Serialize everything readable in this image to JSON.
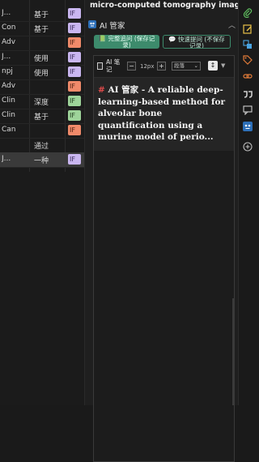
{
  "left_table": {
    "rows": [
      {
        "col1": "J...",
        "col2": "基于",
        "tag": "IF",
        "tag_color": "#c9b6f0"
      },
      {
        "col1": "Con",
        "col2": "基于",
        "tag": "IF",
        "tag_color": "#c9b6f0"
      },
      {
        "col1": "Adv",
        "col2": "",
        "tag": "IF",
        "tag_color": "#f08a6a"
      },
      {
        "col1": "J...",
        "col2": "使用",
        "tag": "IF",
        "tag_color": "#c9b6f0"
      },
      {
        "col1": "npj",
        "col2": "使用",
        "tag": "IF",
        "tag_color": "#c9b6f0"
      },
      {
        "col1": "Adv",
        "col2": "",
        "tag": "IF",
        "tag_color": "#f08a6a"
      },
      {
        "col1": "Clin",
        "col2": "深度",
        "tag": "IF",
        "tag_color": "#9ed49a"
      },
      {
        "col1": "Clin",
        "col2": "基于",
        "tag": "IF",
        "tag_color": "#9ed49a"
      },
      {
        "col1": "Can",
        "col2": "",
        "tag": "IF",
        "tag_color": "#f08a6a"
      },
      {
        "col1": "",
        "col2": "通过",
        "tag": "",
        "tag_color": ""
      },
      {
        "col1": "J...",
        "col2": "一种",
        "tag": "IF",
        "tag_color": "#c9b6f0",
        "selected": true
      }
    ]
  },
  "main": {
    "title": "micro-computed tomography imaging",
    "ai_label": "AI 管家",
    "chevron": "︿",
    "btn_full": "📗 完整追问 (保存记录)",
    "btn_quick": "💬 快速提问 (不保存记录)",
    "toolbar": {
      "note_title": "AI 笔记",
      "minus": "−",
      "font_size": "12px",
      "plus": "+",
      "style": "段落",
      "sort": "↕",
      "more": "▼"
    },
    "note": {
      "hash": "#",
      "text": " AI 管家 - A reliable deep-learning-based method for alveolar bone quantification using a murine model of perio..."
    }
  },
  "right_icons": [
    {
      "name": "paperclip-icon",
      "color": "#5fbf5f"
    },
    {
      "name": "note-edit-icon",
      "color": "#e8c14a"
    },
    {
      "name": "translate-icon",
      "color": "#4aa3e0"
    },
    {
      "name": "tag-icon",
      "color": "#e07b39"
    },
    {
      "name": "link-icon",
      "color": "#e07b39"
    },
    {
      "name": "quote-icon",
      "color": "#cccccc"
    },
    {
      "name": "comment-icon",
      "color": "#cccccc"
    },
    {
      "name": "ai-assistant-icon",
      "color": "#4aa3e0"
    },
    {
      "name": "refresh-plus-icon",
      "color": "#bbbbbb"
    }
  ]
}
